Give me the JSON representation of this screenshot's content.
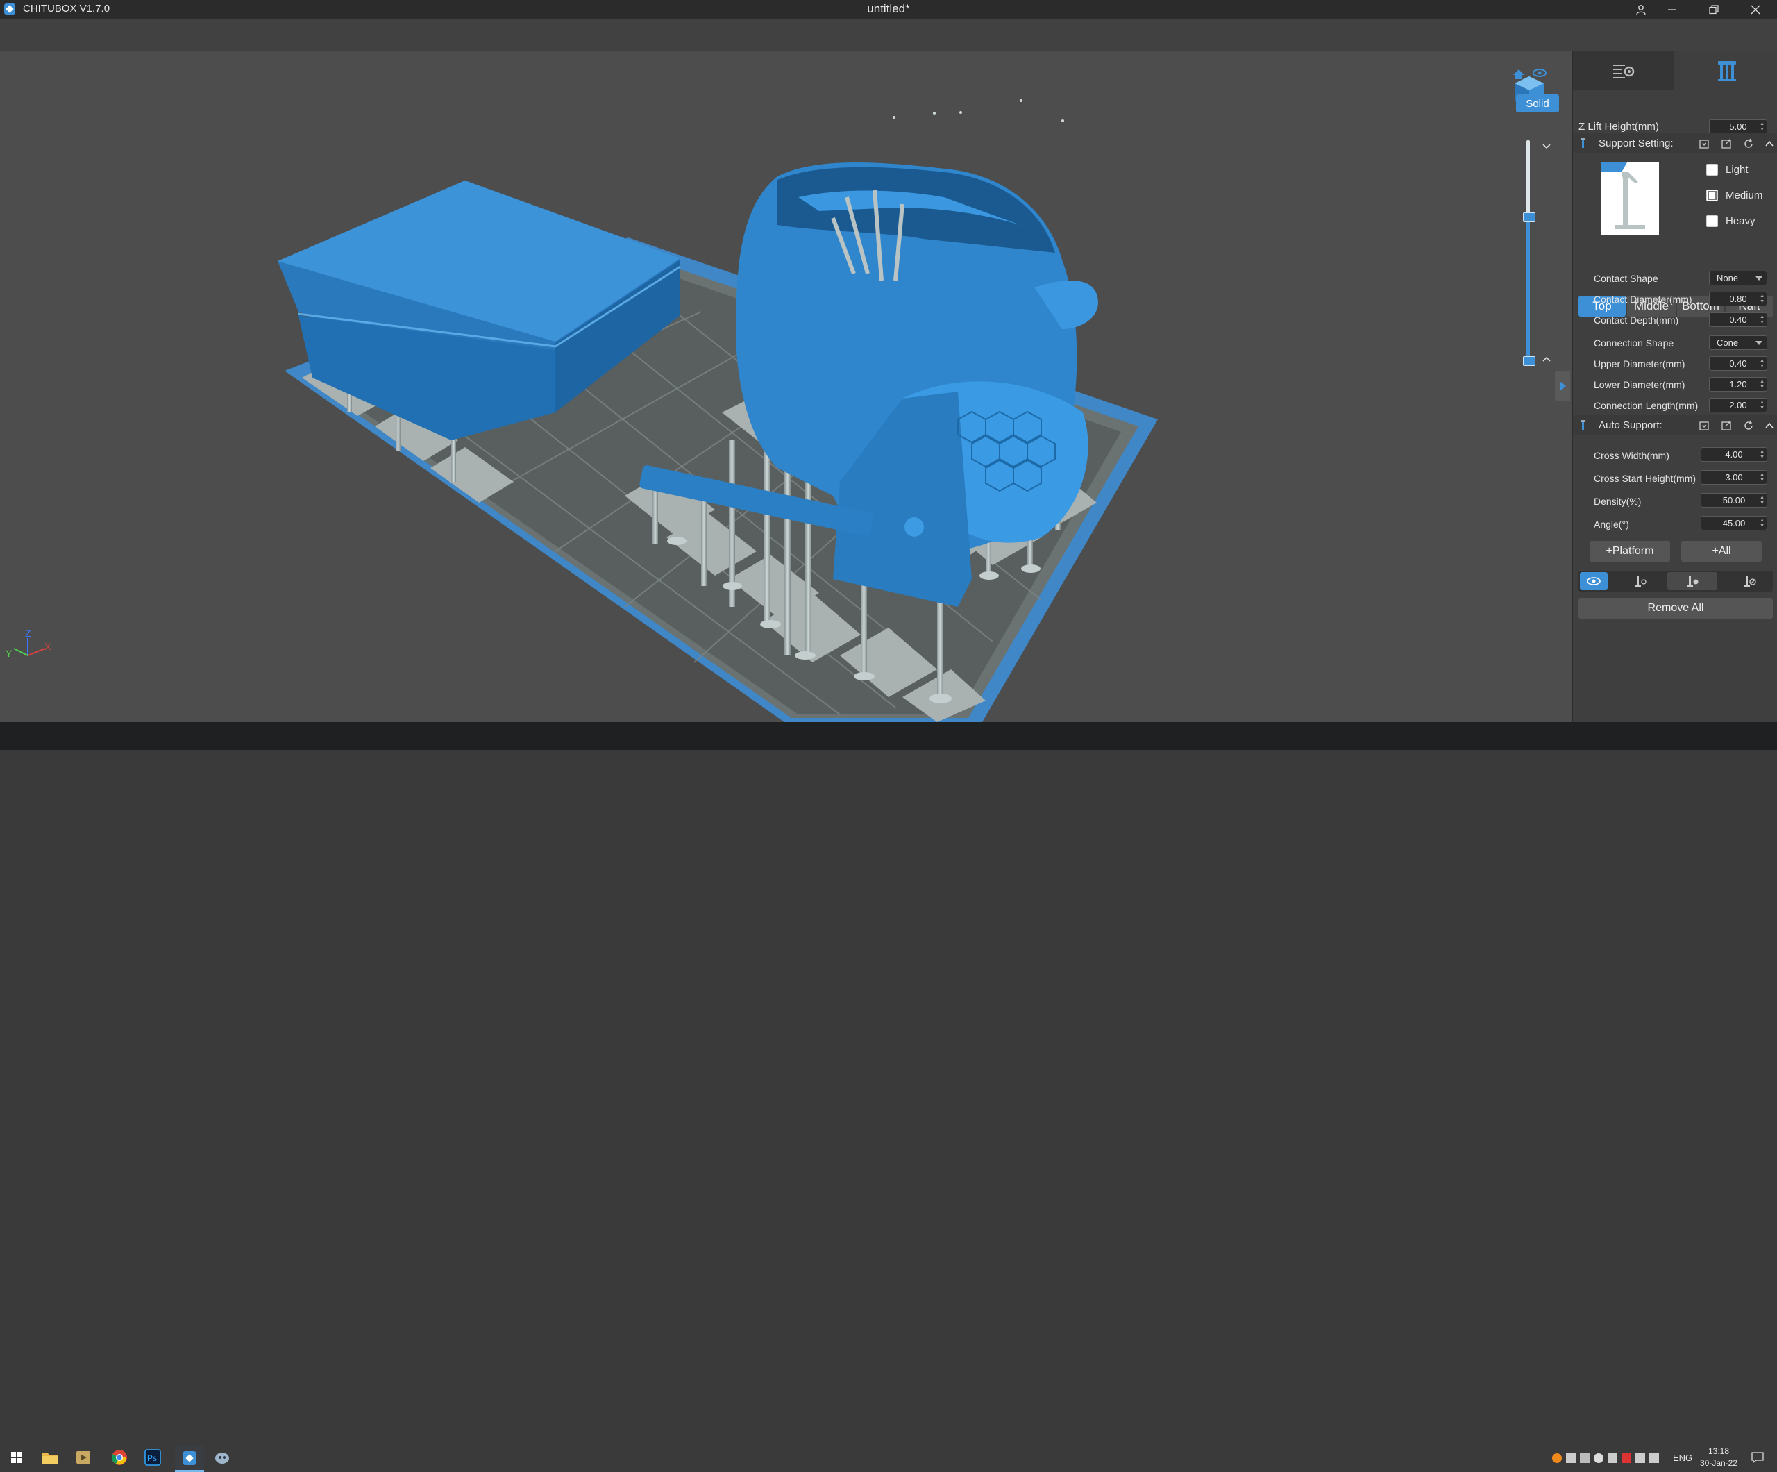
{
  "titlebar": {
    "app_name": "CHITUBOX V1.7.0",
    "document_title": "untitled*"
  },
  "viewport": {
    "render_mode": "Solid"
  },
  "panel": {
    "z_lift": {
      "label": "Z Lift Height(mm)",
      "value": "5.00"
    },
    "support_setting": {
      "title": "Support Setting:",
      "checkboxes": [
        {
          "label": "Light",
          "checked": false
        },
        {
          "label": "Medium",
          "checked": true
        },
        {
          "label": "Heavy",
          "checked": false
        }
      ],
      "tabs": [
        "Top",
        "Middle",
        "Bottom",
        "Raft"
      ],
      "active_tab": "Top",
      "fields": [
        {
          "label": "Contact Shape",
          "value": "None",
          "type": "select"
        },
        {
          "label": "Contact Diameter(mm)",
          "value": "0.80",
          "type": "number"
        },
        {
          "label": "Contact Depth(mm)",
          "value": "0.40",
          "type": "number"
        },
        {
          "label": "Connection Shape",
          "value": "Cone",
          "type": "select"
        },
        {
          "label": "Upper Diameter(mm)",
          "value": "0.40",
          "type": "number"
        },
        {
          "label": "Lower Diameter(mm)",
          "value": "1.20",
          "type": "number"
        },
        {
          "label": "Connection Length(mm)",
          "value": "2.00",
          "type": "number"
        }
      ]
    },
    "auto_support": {
      "title": "Auto Support:",
      "fields": [
        {
          "label": "Cross Width(mm)",
          "value": "4.00"
        },
        {
          "label": "Cross Start Height(mm)",
          "value": "3.00"
        },
        {
          "label": "Density(%)",
          "value": "50.00"
        },
        {
          "label": "Angle(°)",
          "value": "45.00"
        }
      ],
      "platform_button": "+Platform",
      "all_button": "+All"
    },
    "remove_all": "Remove All"
  },
  "taskbar": {
    "lang": "ENG",
    "time": "13:18",
    "date": "30-Jan-22"
  },
  "colors": {
    "accent": "#3d8fd6",
    "model": "#2f86cc",
    "support": "#9aa6a6",
    "viewport_bg": "#4d4d4d"
  }
}
